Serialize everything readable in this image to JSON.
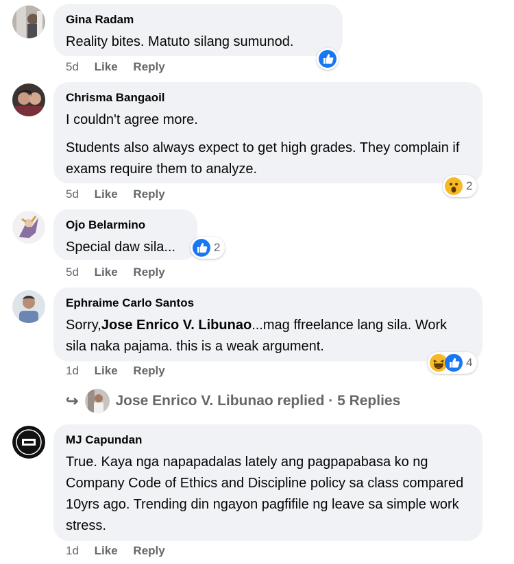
{
  "comments": [
    {
      "author": "Gina Radam",
      "lines": [
        "Reality bites. Matuto silang sumunod."
      ],
      "time": "5d",
      "like": "Like",
      "reply": "Reply",
      "reactions": [
        "like"
      ],
      "reaction_count": ""
    },
    {
      "author": "Chrisma Bangaoil",
      "lines": [
        "I couldn't agree more.",
        "Students also always expect to get high grades. They complain if exams require them to analyze."
      ],
      "time": "5d",
      "like": "Like",
      "reply": "Reply",
      "reactions": [
        "wow"
      ],
      "reaction_count": "2"
    },
    {
      "author": "Ojo Belarmino",
      "lines": [
        "Special daw sila..."
      ],
      "time": "5d",
      "like": "Like",
      "reply": "Reply",
      "reactions": [
        "like"
      ],
      "reaction_count": "2"
    },
    {
      "author": "Ephraime Carlo Santos",
      "text_prefix": "Sorry,",
      "mention": "Jose Enrico V. Libunao",
      "text_suffix": "...mag ffreelance lang sila. Work sila naka pajama. this is a weak argument.",
      "time": "1d",
      "like": "Like",
      "reply": "Reply",
      "reactions": [
        "haha",
        "like"
      ],
      "reaction_count": "4"
    },
    {
      "author": "MJ Capundan",
      "lines": [
        "True. Kaya nga napapadalas lately ang pagpapabasa ko ng Company Code of Ethics and Discipline policy sa class compared 10yrs ago. Trending din ngayon pagfifile ng leave sa simple work stress."
      ],
      "time": "1d",
      "like": "Like",
      "reply": "Reply",
      "reactions": [],
      "reaction_count": ""
    }
  ],
  "replies_row": {
    "text": "Jose Enrico V. Libunao replied · 5 Replies"
  },
  "colors": {
    "bubble": "#f0f2f5",
    "meta": "#65676b",
    "like_blue": "#1877f2",
    "emoji_yellow": "#f7b928"
  }
}
